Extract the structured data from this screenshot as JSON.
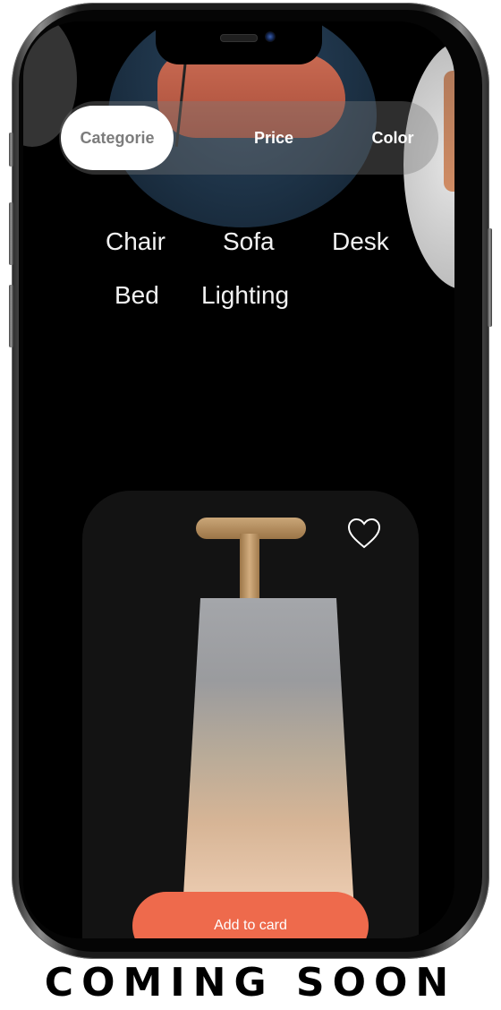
{
  "tabs": [
    {
      "label": "Categorie",
      "active": true
    },
    {
      "label": "Price",
      "active": false
    },
    {
      "label": "Color",
      "active": false
    }
  ],
  "categories": [
    "Chair",
    "Sofa",
    "Desk",
    "Bed",
    "Lighting"
  ],
  "product": {
    "favorite_icon": "heart-outline-icon",
    "add_button_label": "Add to card"
  },
  "banner": {
    "text": "COMING SOON"
  },
  "colors": {
    "accent": "#ee6a4c",
    "screen_bg": "#000000",
    "card_bg": "#131313"
  }
}
